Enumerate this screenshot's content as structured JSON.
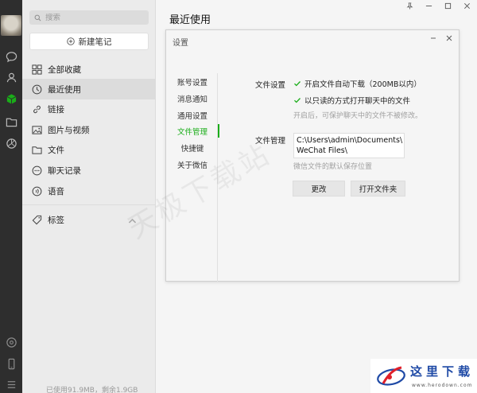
{
  "sidebar": {
    "search_placeholder": "搜索",
    "new_note_label": "新建笔记",
    "items": [
      {
        "label": "全部收藏",
        "icon": "grid-icon"
      },
      {
        "label": "最近使用",
        "icon": "clock-icon",
        "active": true
      },
      {
        "label": "链接",
        "icon": "link-icon"
      },
      {
        "label": "图片与视频",
        "icon": "image-icon"
      },
      {
        "label": "文件",
        "icon": "folder-icon"
      },
      {
        "label": "聊天记录",
        "icon": "chat-icon"
      },
      {
        "label": "语音",
        "icon": "voice-icon"
      }
    ],
    "tags_label": "标签",
    "storage": "已使用91.9MB，剩余1.9GB"
  },
  "main": {
    "title": "最近使用"
  },
  "settings": {
    "title": "设置",
    "nav": [
      "账号设置",
      "消息通知",
      "通用设置",
      "文件管理",
      "快捷键",
      "关于微信"
    ],
    "active_nav": "文件管理",
    "file_settings_label": "文件设置",
    "auto_download": "开启文件自动下载（200MB以内）",
    "read_only_open": "以只读的方式打开聊天中的文件",
    "read_only_hint": "开启后，可保护聊天中的文件不被修改。",
    "file_manage_label": "文件管理",
    "save_path": "C:\\Users\\admin\\Documents\\\nWeChat Files\\",
    "save_path_hint": "微信文件的默认保存位置",
    "change_button": "更改",
    "open_folder_button": "打开文件夹"
  },
  "watermark": "天极下载站",
  "logo": {
    "text": "这里下载",
    "url": "www.herodown.com"
  },
  "colors": {
    "accent": "#1aad19",
    "rail": "#2e2e2e",
    "sidebar": "#ebebeb"
  }
}
